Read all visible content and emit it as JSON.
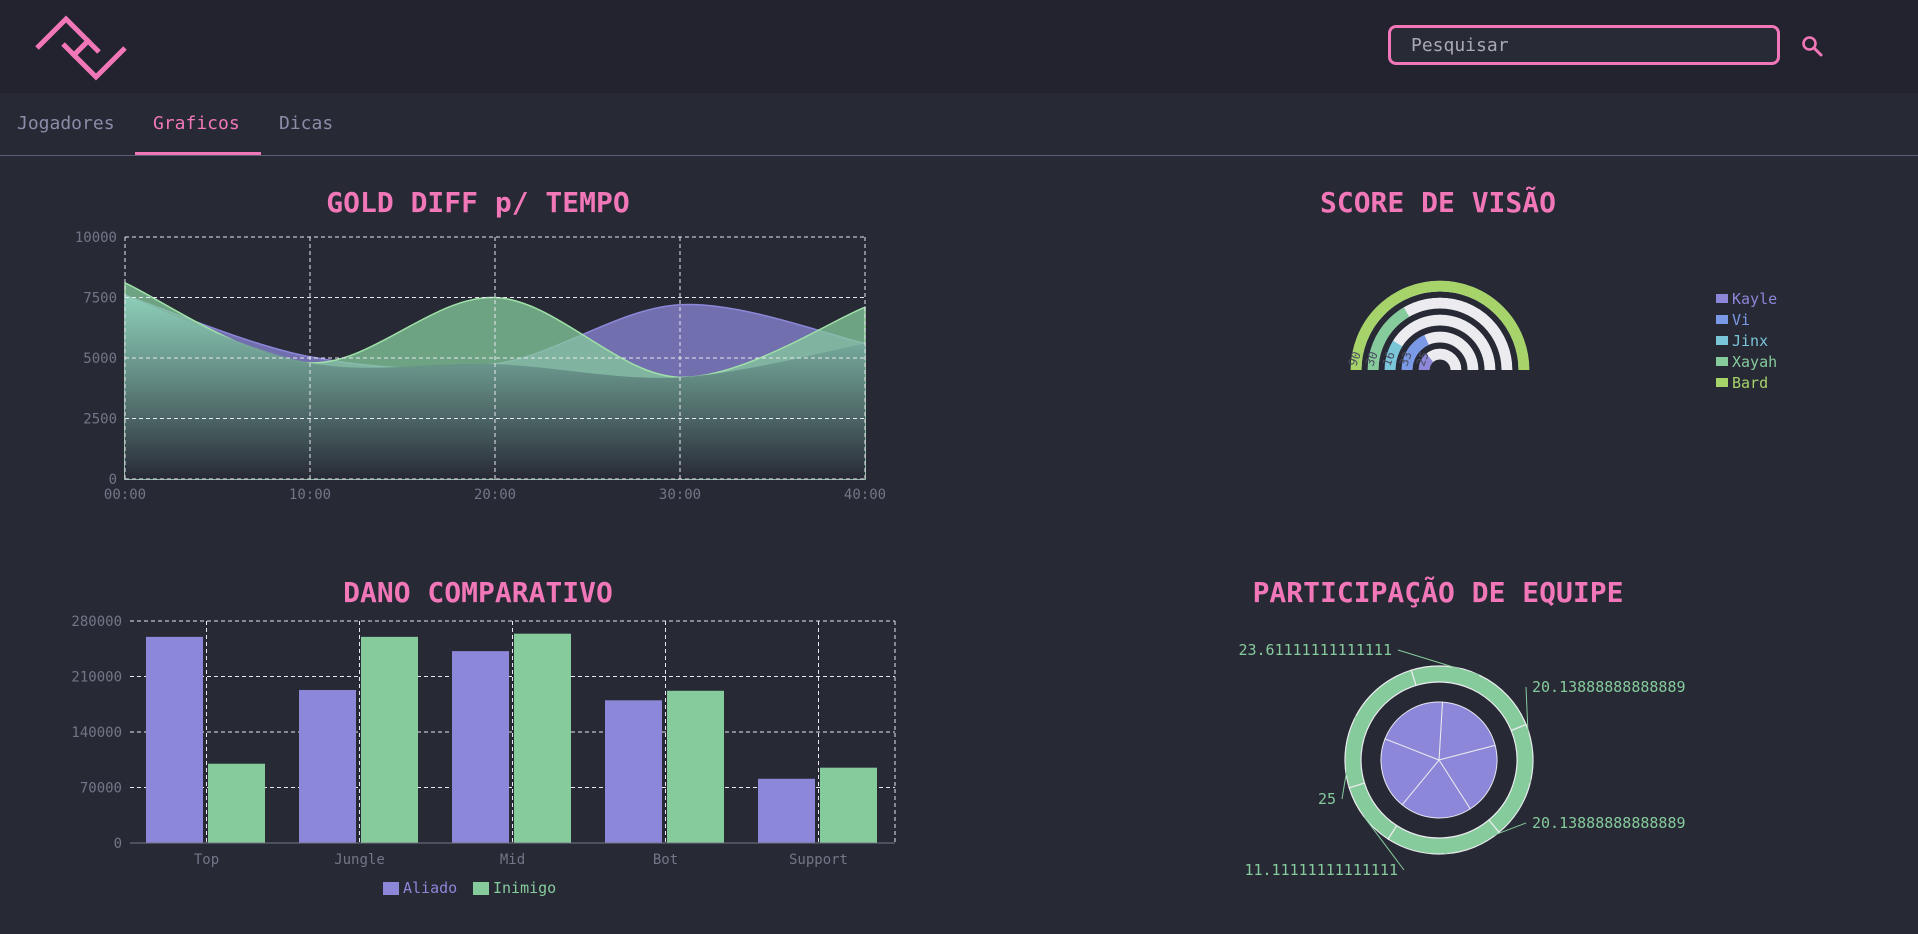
{
  "header": {
    "search_placeholder": "Pesquisar"
  },
  "nav": {
    "tabs": [
      {
        "label": "Jogadores",
        "active": false
      },
      {
        "label": "Graficos",
        "active": true
      },
      {
        "label": "Dicas",
        "active": false
      }
    ]
  },
  "colors": {
    "accent": "#f277b8",
    "purple": "#8c87d8",
    "green": "#86cb9c",
    "lime": "#a6d46a",
    "blue": "#7a9ae8",
    "cyan": "#7bc5d9",
    "background": "#272935"
  },
  "charts": {
    "gold": {
      "title": "GOLD DIFF p/ TEMPO"
    },
    "vision": {
      "title": "SCORE DE VISÃO"
    },
    "damage": {
      "title": "DANO COMPARATIVO"
    },
    "participation": {
      "title": "PARTICIPAÇÃO DE EQUIPE"
    }
  },
  "chart_data": [
    {
      "id": "gold",
      "type": "area",
      "title": "GOLD DIFF p/ TEMPO",
      "x": [
        "00:00",
        "10:00",
        "20:00",
        "30:00",
        "40:00"
      ],
      "ylim": [
        0,
        10000
      ],
      "yticks": [
        0,
        2500,
        5000,
        7500,
        10000
      ],
      "grid": true,
      "series": [
        {
          "values": [
            7600,
            5050,
            4750,
            7200,
            5600
          ]
        },
        {
          "values": [
            8100,
            4800,
            7500,
            4200,
            7100
          ]
        }
      ]
    },
    {
      "id": "vision",
      "type": "pie",
      "title": "SCORE DE VISÃO",
      "categories": [
        "Kayle",
        "Vi",
        "Jinx",
        "Xayah",
        "Bard"
      ],
      "values": [
        25,
        33,
        16,
        30,
        90
      ],
      "legend": "right"
    },
    {
      "id": "damage",
      "type": "bar",
      "title": "DANO COMPARATIVO",
      "categories": [
        "Top",
        "Jungle",
        "Mid",
        "Bot",
        "Support"
      ],
      "ylim": [
        0,
        280000
      ],
      "yticks": [
        0,
        70000,
        140000,
        210000,
        280000
      ],
      "grid": true,
      "legend": "bottom",
      "series": [
        {
          "name": "Aliado",
          "values": [
            260000,
            193000,
            242000,
            180000,
            81000
          ]
        },
        {
          "name": "Inimigo",
          "values": [
            100000,
            260000,
            264000,
            192000,
            95000
          ]
        }
      ]
    },
    {
      "id": "participation",
      "type": "pie",
      "title": "PARTICIPAÇÃO DE EQUIPE",
      "inner_values": [
        20,
        20,
        20,
        20,
        20
      ],
      "outer_values": [
        23.61111111111111,
        20.13888888888889,
        20.13888888888889,
        11.11111111111111,
        25
      ],
      "outer_labels": [
        "23.61111111111111",
        "20.13888888888889",
        "20.13888888888889",
        "11.11111111111111",
        "25"
      ]
    }
  ]
}
